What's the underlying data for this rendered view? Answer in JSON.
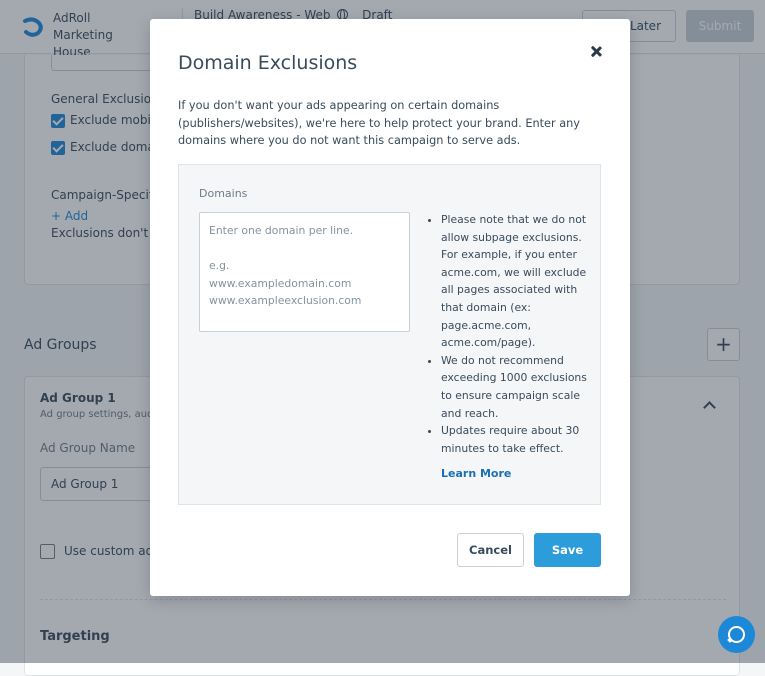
{
  "header": {
    "org_name": "AdRoll Marketing House Campaigns",
    "campaign_name": "Build Awareness - Web",
    "status": "Draft",
    "save_later_label": "Later",
    "submit_label": "Submit"
  },
  "exclusions_card": {
    "general_label": "General Exclusions",
    "checkbox_mobile": "Exclude mobile",
    "checkbox_domain": "Exclude domain",
    "campaign_specific_label": "Campaign-Specific",
    "add_label": "+ Add",
    "note": "Exclusions don't ap"
  },
  "ad_groups": {
    "section_title": "Ad Groups",
    "add_icon": "plus-icon",
    "group_title": "Ad Group 1",
    "group_subtitle": "Ad group settings, audie",
    "name_label": "Ad Group Name",
    "name_value": "Ad Group 1",
    "custom_label": "Use custom ad g",
    "targeting_label": "Targeting"
  },
  "modal": {
    "title": "Domain Exclusions",
    "close_icon": "close-icon",
    "description": "If you don't want your ads appearing on certain domains (publishers/websites), we're here to help protect your brand. Enter any domains where you do not want this campaign to serve ads.",
    "domains_label": "Domains",
    "domains_placeholder": "Enter one domain per line.\n\ne.g.\nwww.exampledomain.com\nwww.exampleexclusion.com",
    "domains_value": "",
    "notes": [
      "Please note that we do not allow subpage exclusions. For example, if you enter acme.com, we will exclude all pages associated with that domain (ex: page.acme.com, acme.com/page).",
      "We do not recommend exceeding 1000 exclusions to ensure campaign scale and reach.",
      "Updates require about 30 minutes to take effect."
    ],
    "learn_more_label": "Learn More",
    "cancel_label": "Cancel",
    "save_label": "Save"
  },
  "chat": {
    "icon": "chat-icon"
  },
  "colors": {
    "primary": "#2d9cdb",
    "link": "#1a6fb5",
    "text": "#394b5c",
    "overlay": "#263242"
  }
}
